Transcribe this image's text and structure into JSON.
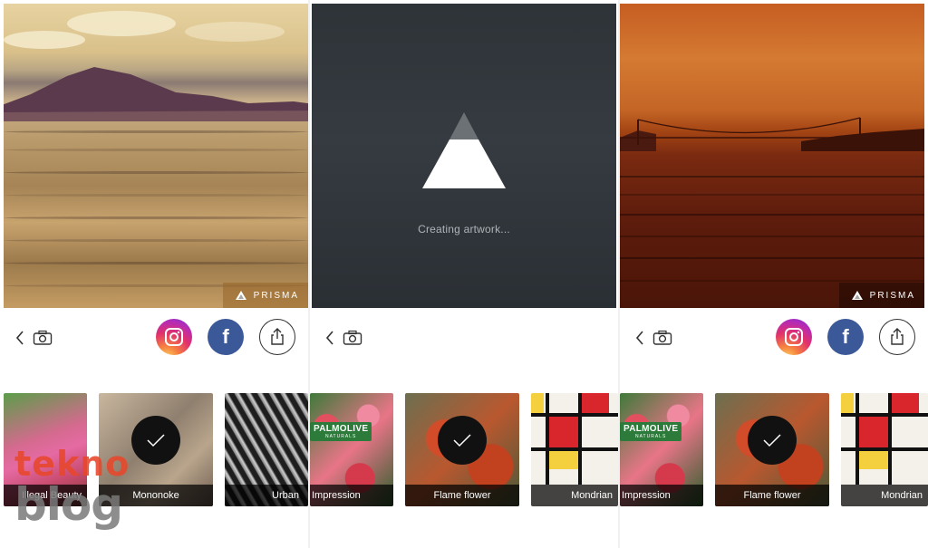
{
  "panels": [
    {
      "artwork": {
        "badge_text": "PRISMA"
      },
      "filters": [
        {
          "label": "Illegal Beauty"
        },
        {
          "label": "Mononoke"
        },
        {
          "label": "Urban"
        }
      ]
    },
    {
      "artwork": {
        "status_text": "Creating artwork..."
      },
      "filters": [
        {
          "label": "Impression"
        },
        {
          "label": "Flame flower"
        },
        {
          "label": "Mondrian"
        }
      ]
    },
    {
      "artwork": {
        "badge_text": "PRISMA"
      },
      "filters": [
        {
          "label": "Impression"
        },
        {
          "label": "Flame flower"
        },
        {
          "label": "Mondrian"
        }
      ]
    }
  ],
  "social": {
    "facebook_letter": "f"
  },
  "brand_text": {
    "palmolive": "PALMOLIVE",
    "palmolive_sub": "NATURALS"
  },
  "watermark": {
    "line1": "tekno",
    "line2": "blog"
  },
  "colors": {
    "instagram": "#e1306c",
    "facebook": "#3b5998",
    "loading_bg": "#2e3338",
    "watermark_red": "#e8472b"
  },
  "icons": {
    "back": "chevron-left-icon",
    "camera": "camera-icon",
    "share": "share-icon",
    "check": "checkmark-icon",
    "prisma": "prisma-triangle-icon"
  }
}
